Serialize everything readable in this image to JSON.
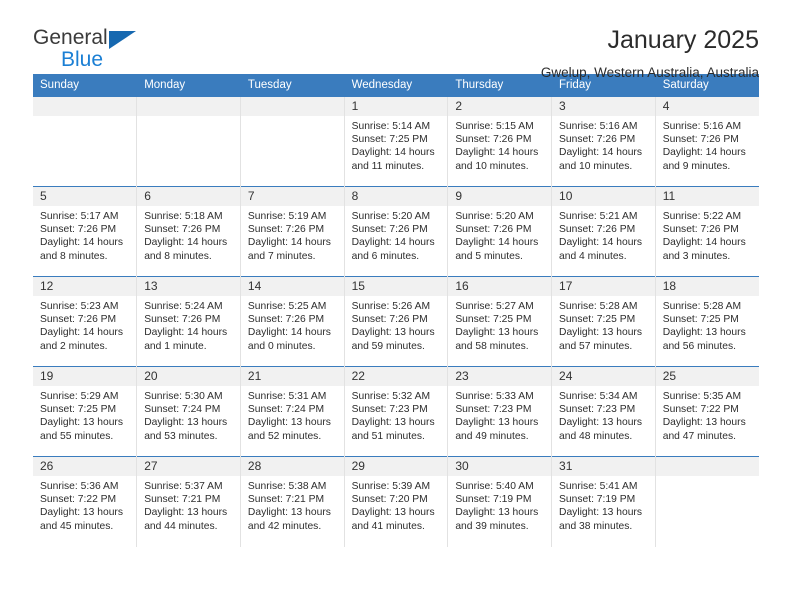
{
  "brand": {
    "name_top": "General",
    "name_bottom": "Blue",
    "logo_icon": "triangle-icon",
    "accent_color": "#1b7fd4"
  },
  "header": {
    "title": "January 2025",
    "subtitle": "Gwelup, Western Australia, Australia"
  },
  "calendar": {
    "header_color": "#3a7cbe",
    "weekday_headers": [
      "Sunday",
      "Monday",
      "Tuesday",
      "Wednesday",
      "Thursday",
      "Friday",
      "Saturday"
    ],
    "weeks": [
      [
        {
          "day": "",
          "sunrise": "",
          "sunset": "",
          "daylight": ""
        },
        {
          "day": "",
          "sunrise": "",
          "sunset": "",
          "daylight": ""
        },
        {
          "day": "",
          "sunrise": "",
          "sunset": "",
          "daylight": ""
        },
        {
          "day": "1",
          "sunrise": "Sunrise: 5:14 AM",
          "sunset": "Sunset: 7:25 PM",
          "daylight": "Daylight: 14 hours and 11 minutes."
        },
        {
          "day": "2",
          "sunrise": "Sunrise: 5:15 AM",
          "sunset": "Sunset: 7:26 PM",
          "daylight": "Daylight: 14 hours and 10 minutes."
        },
        {
          "day": "3",
          "sunrise": "Sunrise: 5:16 AM",
          "sunset": "Sunset: 7:26 PM",
          "daylight": "Daylight: 14 hours and 10 minutes."
        },
        {
          "day": "4",
          "sunrise": "Sunrise: 5:16 AM",
          "sunset": "Sunset: 7:26 PM",
          "daylight": "Daylight: 14 hours and 9 minutes."
        }
      ],
      [
        {
          "day": "5",
          "sunrise": "Sunrise: 5:17 AM",
          "sunset": "Sunset: 7:26 PM",
          "daylight": "Daylight: 14 hours and 8 minutes."
        },
        {
          "day": "6",
          "sunrise": "Sunrise: 5:18 AM",
          "sunset": "Sunset: 7:26 PM",
          "daylight": "Daylight: 14 hours and 8 minutes."
        },
        {
          "day": "7",
          "sunrise": "Sunrise: 5:19 AM",
          "sunset": "Sunset: 7:26 PM",
          "daylight": "Daylight: 14 hours and 7 minutes."
        },
        {
          "day": "8",
          "sunrise": "Sunrise: 5:20 AM",
          "sunset": "Sunset: 7:26 PM",
          "daylight": "Daylight: 14 hours and 6 minutes."
        },
        {
          "day": "9",
          "sunrise": "Sunrise: 5:20 AM",
          "sunset": "Sunset: 7:26 PM",
          "daylight": "Daylight: 14 hours and 5 minutes."
        },
        {
          "day": "10",
          "sunrise": "Sunrise: 5:21 AM",
          "sunset": "Sunset: 7:26 PM",
          "daylight": "Daylight: 14 hours and 4 minutes."
        },
        {
          "day": "11",
          "sunrise": "Sunrise: 5:22 AM",
          "sunset": "Sunset: 7:26 PM",
          "daylight": "Daylight: 14 hours and 3 minutes."
        }
      ],
      [
        {
          "day": "12",
          "sunrise": "Sunrise: 5:23 AM",
          "sunset": "Sunset: 7:26 PM",
          "daylight": "Daylight: 14 hours and 2 minutes."
        },
        {
          "day": "13",
          "sunrise": "Sunrise: 5:24 AM",
          "sunset": "Sunset: 7:26 PM",
          "daylight": "Daylight: 14 hours and 1 minute."
        },
        {
          "day": "14",
          "sunrise": "Sunrise: 5:25 AM",
          "sunset": "Sunset: 7:26 PM",
          "daylight": "Daylight: 14 hours and 0 minutes."
        },
        {
          "day": "15",
          "sunrise": "Sunrise: 5:26 AM",
          "sunset": "Sunset: 7:26 PM",
          "daylight": "Daylight: 13 hours and 59 minutes."
        },
        {
          "day": "16",
          "sunrise": "Sunrise: 5:27 AM",
          "sunset": "Sunset: 7:25 PM",
          "daylight": "Daylight: 13 hours and 58 minutes."
        },
        {
          "day": "17",
          "sunrise": "Sunrise: 5:28 AM",
          "sunset": "Sunset: 7:25 PM",
          "daylight": "Daylight: 13 hours and 57 minutes."
        },
        {
          "day": "18",
          "sunrise": "Sunrise: 5:28 AM",
          "sunset": "Sunset: 7:25 PM",
          "daylight": "Daylight: 13 hours and 56 minutes."
        }
      ],
      [
        {
          "day": "19",
          "sunrise": "Sunrise: 5:29 AM",
          "sunset": "Sunset: 7:25 PM",
          "daylight": "Daylight: 13 hours and 55 minutes."
        },
        {
          "day": "20",
          "sunrise": "Sunrise: 5:30 AM",
          "sunset": "Sunset: 7:24 PM",
          "daylight": "Daylight: 13 hours and 53 minutes."
        },
        {
          "day": "21",
          "sunrise": "Sunrise: 5:31 AM",
          "sunset": "Sunset: 7:24 PM",
          "daylight": "Daylight: 13 hours and 52 minutes."
        },
        {
          "day": "22",
          "sunrise": "Sunrise: 5:32 AM",
          "sunset": "Sunset: 7:23 PM",
          "daylight": "Daylight: 13 hours and 51 minutes."
        },
        {
          "day": "23",
          "sunrise": "Sunrise: 5:33 AM",
          "sunset": "Sunset: 7:23 PM",
          "daylight": "Daylight: 13 hours and 49 minutes."
        },
        {
          "day": "24",
          "sunrise": "Sunrise: 5:34 AM",
          "sunset": "Sunset: 7:23 PM",
          "daylight": "Daylight: 13 hours and 48 minutes."
        },
        {
          "day": "25",
          "sunrise": "Sunrise: 5:35 AM",
          "sunset": "Sunset: 7:22 PM",
          "daylight": "Daylight: 13 hours and 47 minutes."
        }
      ],
      [
        {
          "day": "26",
          "sunrise": "Sunrise: 5:36 AM",
          "sunset": "Sunset: 7:22 PM",
          "daylight": "Daylight: 13 hours and 45 minutes."
        },
        {
          "day": "27",
          "sunrise": "Sunrise: 5:37 AM",
          "sunset": "Sunset: 7:21 PM",
          "daylight": "Daylight: 13 hours and 44 minutes."
        },
        {
          "day": "28",
          "sunrise": "Sunrise: 5:38 AM",
          "sunset": "Sunset: 7:21 PM",
          "daylight": "Daylight: 13 hours and 42 minutes."
        },
        {
          "day": "29",
          "sunrise": "Sunrise: 5:39 AM",
          "sunset": "Sunset: 7:20 PM",
          "daylight": "Daylight: 13 hours and 41 minutes."
        },
        {
          "day": "30",
          "sunrise": "Sunrise: 5:40 AM",
          "sunset": "Sunset: 7:19 PM",
          "daylight": "Daylight: 13 hours and 39 minutes."
        },
        {
          "day": "31",
          "sunrise": "Sunrise: 5:41 AM",
          "sunset": "Sunset: 7:19 PM",
          "daylight": "Daylight: 13 hours and 38 minutes."
        },
        {
          "day": "",
          "sunrise": "",
          "sunset": "",
          "daylight": ""
        }
      ]
    ]
  }
}
